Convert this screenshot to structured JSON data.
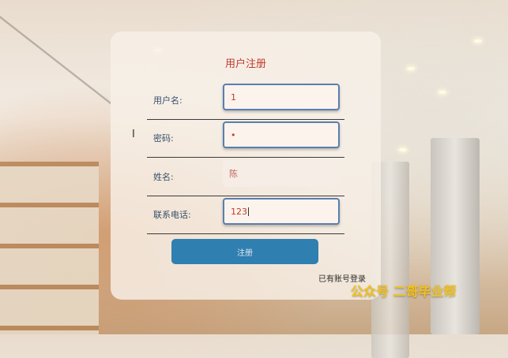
{
  "form": {
    "title": "用户注册",
    "fields": [
      {
        "label": "用户名:",
        "value": "1"
      },
      {
        "label": "密码:",
        "value": "•"
      },
      {
        "label": "姓名:",
        "value": "陈"
      },
      {
        "label": "联系电话:",
        "value": "123"
      }
    ],
    "submit_label": "注册",
    "login_link": "已有账号登录"
  },
  "watermark": "公众号 二哥毕业帮",
  "colors": {
    "accent": "#c0392b",
    "button": "#2f7fb0",
    "field_border": "#5a7fb0"
  }
}
